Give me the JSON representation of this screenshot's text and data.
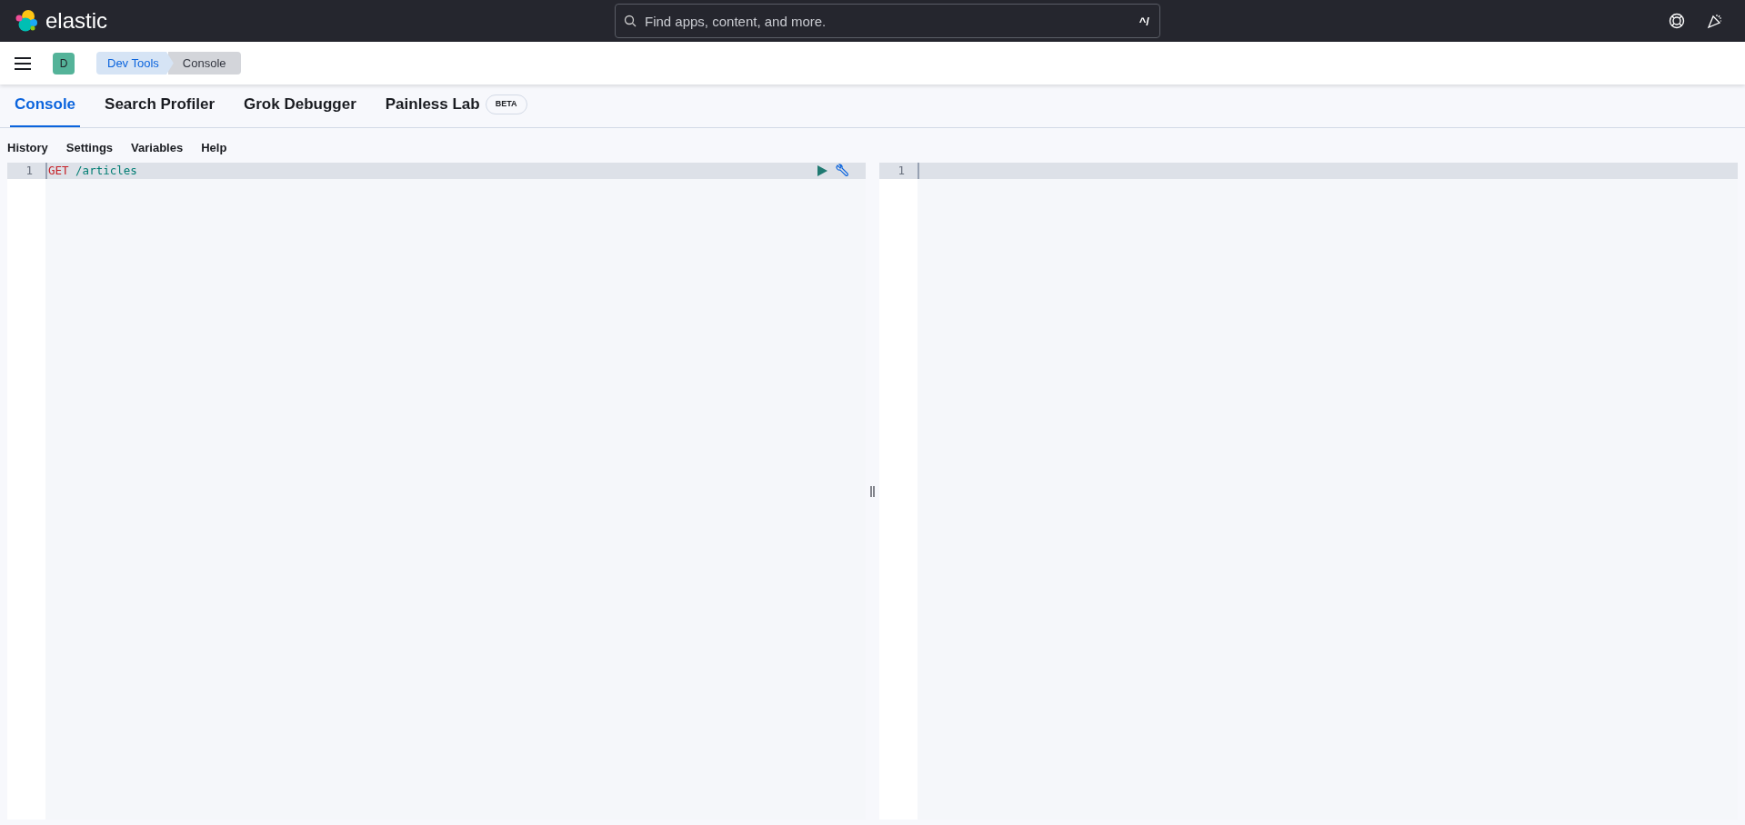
{
  "header": {
    "logo_text": "elastic",
    "search": {
      "placeholder": "Find apps, content, and more.",
      "shortcut": "^/"
    }
  },
  "breadcrumbs": {
    "space_initial": "D",
    "items": [
      {
        "label": "Dev Tools",
        "selected": false
      },
      {
        "label": "Console",
        "selected": true
      }
    ]
  },
  "tabs": [
    {
      "label": "Console",
      "selected": true
    },
    {
      "label": "Search Profiler",
      "selected": false
    },
    {
      "label": "Grok Debugger",
      "selected": false
    },
    {
      "label": "Painless Lab",
      "selected": false,
      "badge": "BETA"
    }
  ],
  "toolbar": [
    "History",
    "Settings",
    "Variables",
    "Help"
  ],
  "request_editor": {
    "lines": [
      {
        "number": "1",
        "tokens": [
          {
            "kind": "method",
            "text": "GET"
          },
          {
            "kind": "path",
            "text": "/articles"
          }
        ]
      }
    ]
  },
  "response_editor": {
    "lines": [
      {
        "number": "1"
      }
    ]
  }
}
